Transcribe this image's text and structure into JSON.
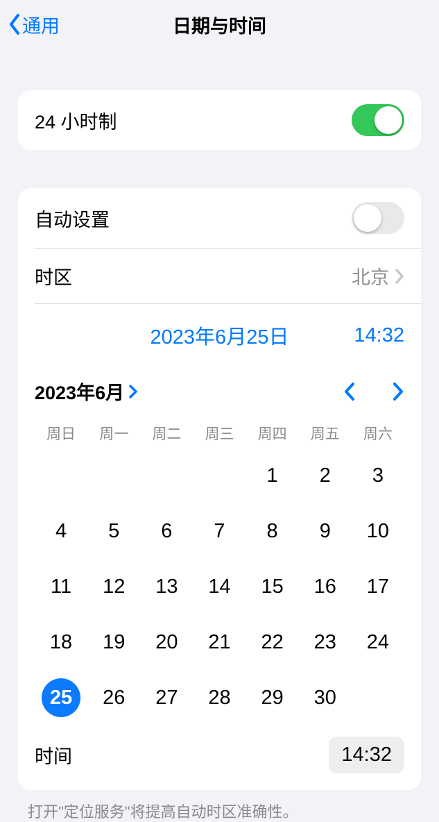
{
  "nav": {
    "back_label": "通用",
    "title": "日期与时间"
  },
  "settings": {
    "twenty_four_hour_label": "24 小时制",
    "twenty_four_hour_on": true,
    "auto_set_label": "自动设置",
    "auto_set_on": false,
    "timezone_label": "时区",
    "timezone_value": "北京"
  },
  "datetime": {
    "selected_date_display": "2023年6月25日",
    "selected_time_display": "14:32",
    "month_title": "2023年6月",
    "weekdays": [
      "周日",
      "周一",
      "周二",
      "周三",
      "周四",
      "周五",
      "周六"
    ],
    "first_weekday_index": 4,
    "days_in_month": 30,
    "selected_day": 25,
    "time_label": "时间",
    "time_value": "14:32"
  },
  "footer": {
    "note": "打开\"定位服务\"将提高自动时区准确性。"
  }
}
